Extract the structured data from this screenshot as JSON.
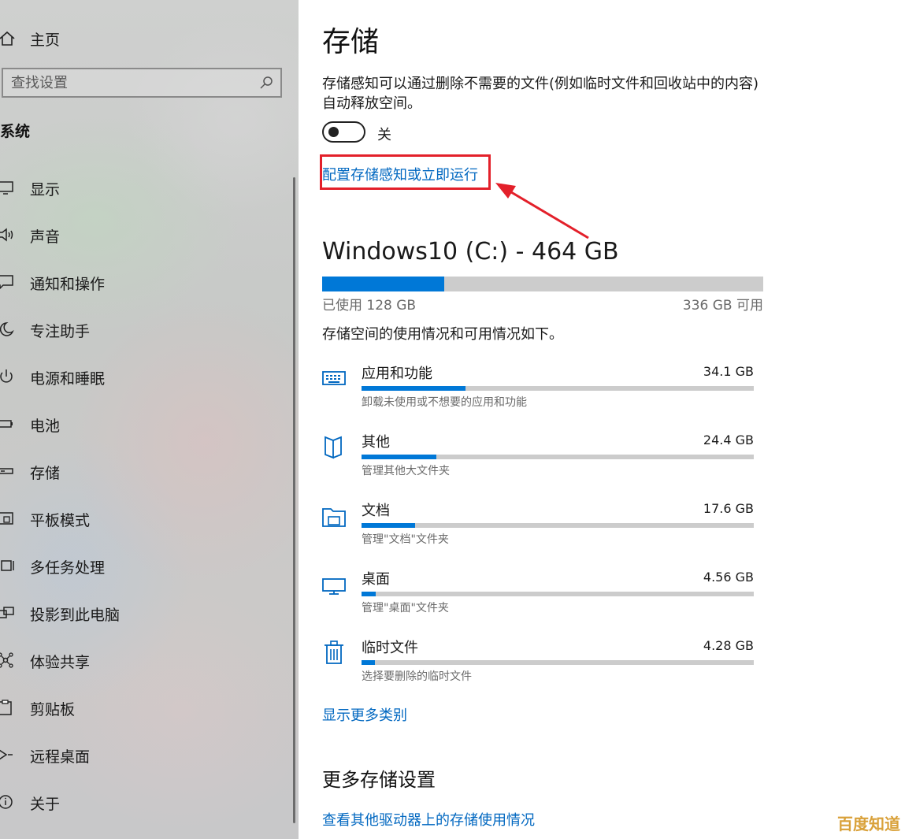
{
  "sidebar": {
    "home_label": "主页",
    "search_placeholder": "查找设置",
    "section_title": "系统",
    "items": [
      {
        "label": "显示",
        "icon": "monitor-icon"
      },
      {
        "label": "声音",
        "icon": "speaker-icon"
      },
      {
        "label": "通知和操作",
        "icon": "notification-icon"
      },
      {
        "label": "专注助手",
        "icon": "moon-icon"
      },
      {
        "label": "电源和睡眠",
        "icon": "power-icon"
      },
      {
        "label": "电池",
        "icon": "battery-icon"
      },
      {
        "label": "存储",
        "icon": "storage-icon"
      },
      {
        "label": "平板模式",
        "icon": "tablet-icon"
      },
      {
        "label": "多任务处理",
        "icon": "multitask-icon"
      },
      {
        "label": "投影到此电脑",
        "icon": "project-icon"
      },
      {
        "label": "体验共享",
        "icon": "share-icon"
      },
      {
        "label": "剪贴板",
        "icon": "clipboard-icon"
      },
      {
        "label": "远程桌面",
        "icon": "remote-desktop-icon"
      },
      {
        "label": "关于",
        "icon": "info-icon"
      }
    ]
  },
  "main": {
    "title": "存储",
    "description": "存储感知可以通过删除不需要的文件(例如临时文件和回收站中的内容)自动释放空间。",
    "toggle": {
      "state_label": "关",
      "on": false
    },
    "storage_sense_link": "配置存储感知或立即运行",
    "drive": {
      "title": "Windows10 (C:) - 464 GB",
      "used_label": "已使用 128 GB",
      "free_label": "336 GB 可用",
      "used_fraction": 0.276
    },
    "usage_summary": "存储空间的使用情况和可用情况如下。",
    "categories": [
      {
        "name": "应用和功能",
        "size": "34.1 GB",
        "desc": "卸载未使用或不想要的应用和功能",
        "fraction": 0.265,
        "icon": "apps-icon"
      },
      {
        "name": "其他",
        "size": "24.4 GB",
        "desc": "管理其他大文件夹",
        "fraction": 0.19,
        "icon": "other-files-icon"
      },
      {
        "name": "文档",
        "size": "17.6 GB",
        "desc": "管理\"文档\"文件夹",
        "fraction": 0.137,
        "icon": "documents-icon"
      },
      {
        "name": "桌面",
        "size": "4.56 GB",
        "desc": "管理\"桌面\"文件夹",
        "fraction": 0.036,
        "icon": "desktop-icon"
      },
      {
        "name": "临时文件",
        "size": "4.28 GB",
        "desc": "选择要删除的临时文件",
        "fraction": 0.034,
        "icon": "trash-icon"
      }
    ],
    "more_categories_link": "显示更多类别",
    "more_settings_title": "更多存储设置",
    "other_drives_link": "查看其他驱动器上的存储使用情况"
  },
  "watermark": "百度知道",
  "colors": {
    "accent": "#0078d7",
    "link": "#0067c0",
    "annotation": "#e3202a"
  }
}
